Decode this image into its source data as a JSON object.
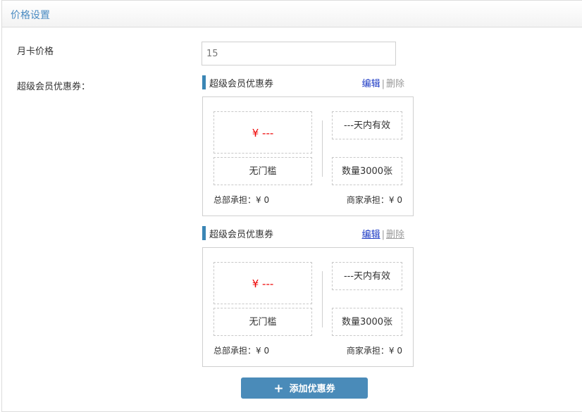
{
  "panel": {
    "title": "价格设置"
  },
  "form": {
    "price_label": "月卡价格",
    "price_value": "15",
    "coupon_label": "超级会员优惠券："
  },
  "coupons": [
    {
      "title": "超级会员优惠券",
      "edit_label": "编辑",
      "separator": "|",
      "delete_label": "删除",
      "amount": "¥ ---",
      "threshold": "无门槛",
      "validity": "---天内有效",
      "quantity": "数量3000张",
      "hq_share": "总部承担：¥ 0",
      "merchant_share": "商家承担：¥ 0"
    },
    {
      "title": "超级会员优惠券",
      "edit_label": "编辑",
      "separator": "|",
      "delete_label": "删除",
      "amount": "¥ ---",
      "threshold": "无门槛",
      "validity": "---天内有效",
      "quantity": "数量3000张",
      "hq_share": "总部承担：¥ 0",
      "merchant_share": "商家承担：¥ 0"
    }
  ],
  "add_button": {
    "icon": "plus-icon",
    "label": "添加优惠券"
  },
  "colors": {
    "accent": "#4a8bb9",
    "amount_red": "#e00000",
    "edit_link": "#1a38c4"
  }
}
